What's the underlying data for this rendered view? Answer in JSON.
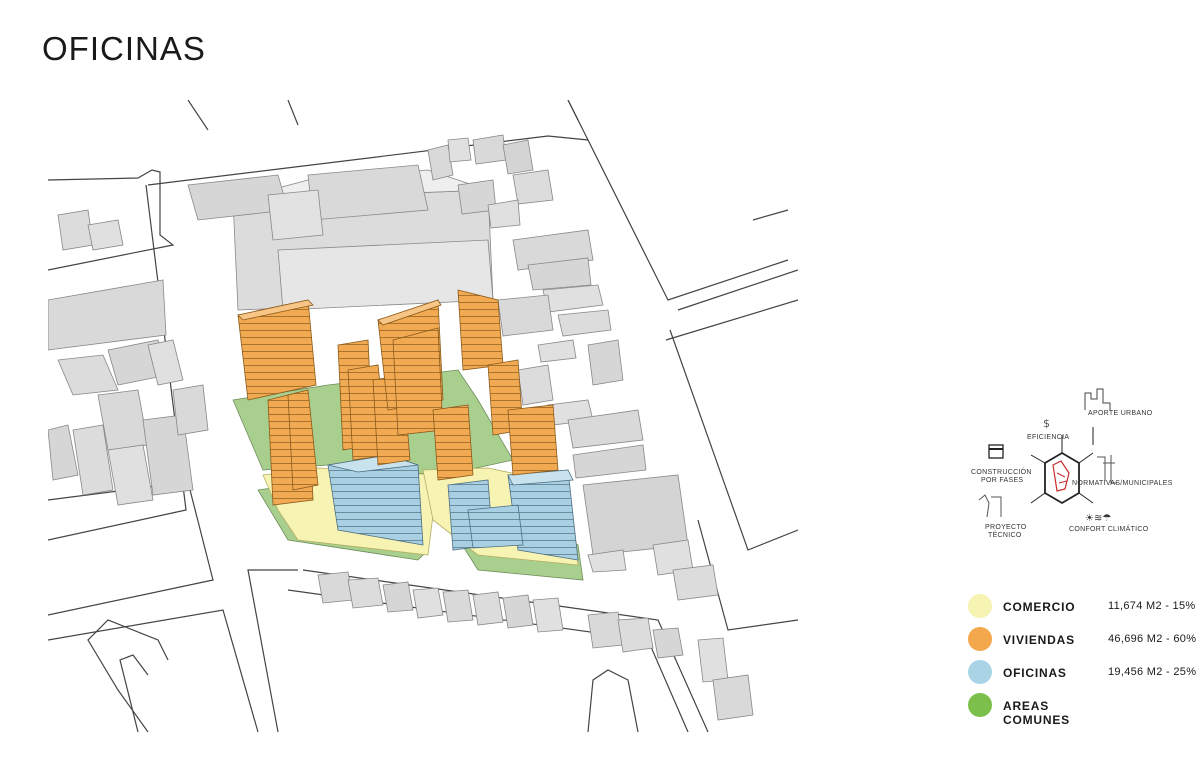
{
  "title": "OFICINAS",
  "diagram": {
    "labels": {
      "aporte": "APORTE URBANO",
      "eficiencia": "EFICIENCIA",
      "construccion_1": "CONSTRUCCIÓN",
      "construccion_2": "POR FASES",
      "normativas": "NORMATIVAS/MUNICIPALES",
      "proyecto_1": "PROYECTO",
      "proyecto_2": "TÉCNICO",
      "confort": "CONFORT CLIMÁTICO"
    }
  },
  "legend": [
    {
      "name": "COMERCIO",
      "value": "11,674 M2 - 15%",
      "color": "#f7f3b3"
    },
    {
      "name": "VIVIENDAS",
      "value": "46,696 M2 - 60%",
      "color": "#f2a84b"
    },
    {
      "name": "OFICINAS",
      "value": "19,456 M2 - 25%",
      "color": "#a9d4e6"
    },
    {
      "name": "AREAS COMUNES",
      "value": "",
      "color": "#7cc04b"
    }
  ],
  "colors": {
    "comercio": "#f7f3b3",
    "viviendas": "#f2a84b",
    "oficinas": "#a9d4e6",
    "areas_comunes": "#a8cf8e",
    "context_buildings": "#d9d9d9",
    "streets": "#ffffff"
  }
}
